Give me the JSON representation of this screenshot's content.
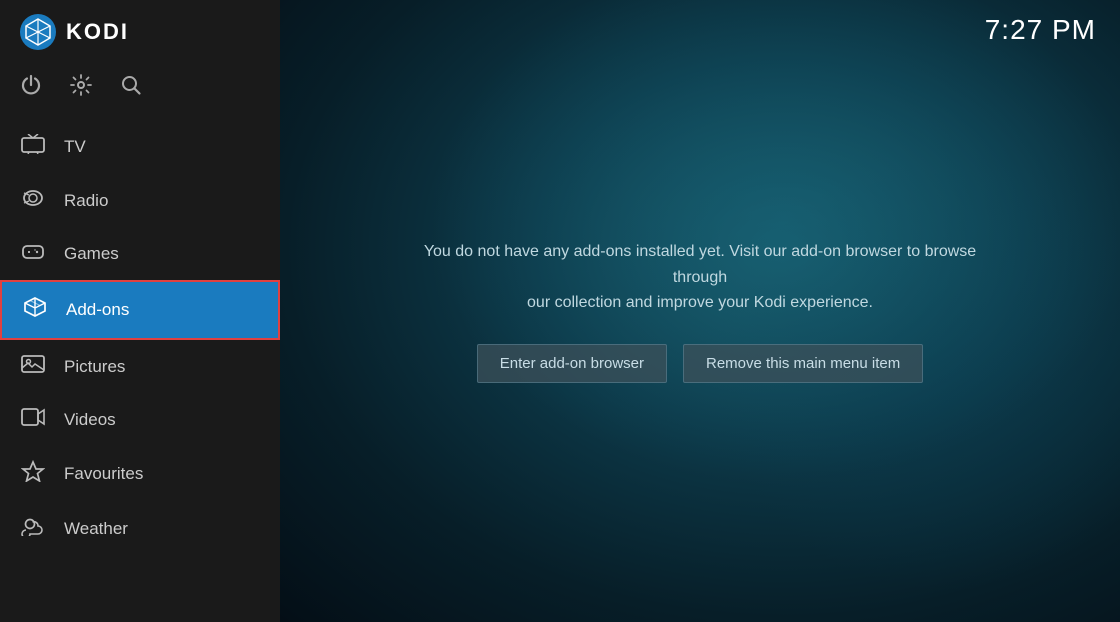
{
  "app": {
    "title": "KODI",
    "clock": "7:27 PM"
  },
  "sidebar": {
    "icons": [
      {
        "name": "power-icon",
        "symbol": "⏻",
        "label": "Power"
      },
      {
        "name": "settings-icon",
        "symbol": "⚙",
        "label": "Settings"
      },
      {
        "name": "search-icon",
        "symbol": "🔍",
        "label": "Search"
      }
    ],
    "nav_items": [
      {
        "id": "tv",
        "label": "TV",
        "icon": "📺",
        "active": false
      },
      {
        "id": "radio",
        "label": "Radio",
        "icon": "📻",
        "active": false
      },
      {
        "id": "games",
        "label": "Games",
        "icon": "🎮",
        "active": false
      },
      {
        "id": "addons",
        "label": "Add-ons",
        "icon": "📦",
        "active": true
      },
      {
        "id": "pictures",
        "label": "Pictures",
        "icon": "🖼",
        "active": false
      },
      {
        "id": "videos",
        "label": "Videos",
        "icon": "🎬",
        "active": false
      },
      {
        "id": "favourites",
        "label": "Favourites",
        "icon": "⭐",
        "active": false
      },
      {
        "id": "weather",
        "label": "Weather",
        "icon": "🌤",
        "active": false
      }
    ]
  },
  "main": {
    "message_line1": "You do not have any add-ons installed yet. Visit our add-on browser to browse through",
    "message_line2": "our collection and improve your Kodi experience.",
    "btn_enter": "Enter add-on browser",
    "btn_remove": "Remove this main menu item"
  }
}
